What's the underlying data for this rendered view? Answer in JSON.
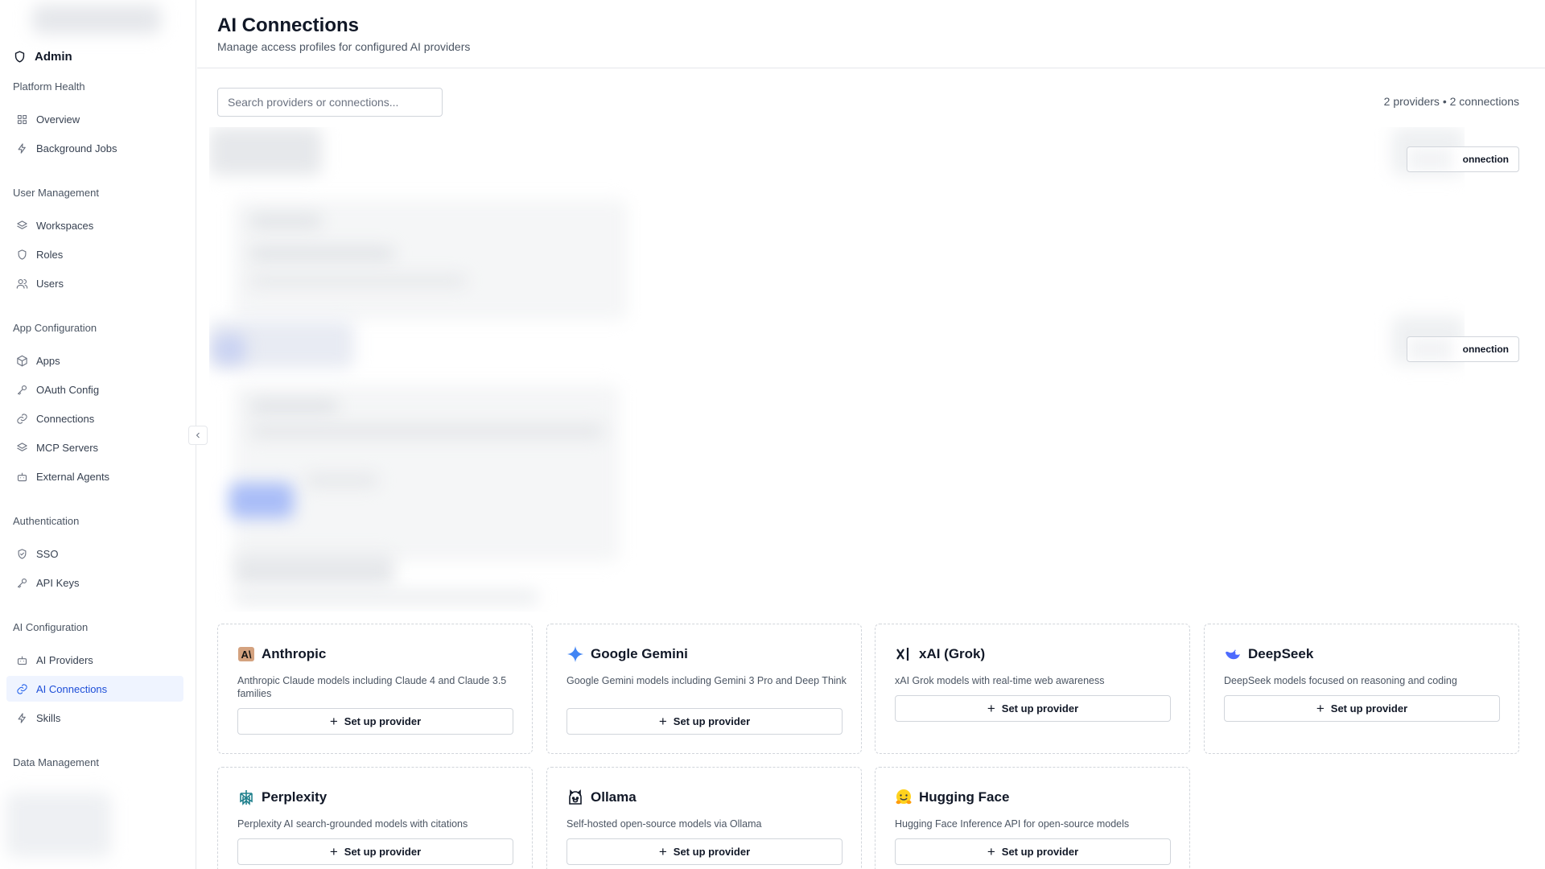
{
  "sidebar": {
    "admin_label": "Admin",
    "sections": [
      {
        "title": "Platform Health",
        "items": [
          {
            "label": "Overview",
            "icon": "grid-icon"
          },
          {
            "label": "Background Jobs",
            "icon": "lightning-icon"
          }
        ]
      },
      {
        "title": "User Management",
        "items": [
          {
            "label": "Workspaces",
            "icon": "layers-icon"
          },
          {
            "label": "Roles",
            "icon": "shield-icon"
          },
          {
            "label": "Users",
            "icon": "users-icon"
          }
        ]
      },
      {
        "title": "App Configuration",
        "items": [
          {
            "label": "Apps",
            "icon": "package-icon"
          },
          {
            "label": "OAuth Config",
            "icon": "key-icon"
          },
          {
            "label": "Connections",
            "icon": "link-icon"
          },
          {
            "label": "MCP Servers",
            "icon": "layers-icon"
          },
          {
            "label": "External Agents",
            "icon": "bot-icon"
          }
        ]
      },
      {
        "title": "Authentication",
        "items": [
          {
            "label": "SSO",
            "icon": "shield-check-icon"
          },
          {
            "label": "API Keys",
            "icon": "key-icon"
          }
        ]
      },
      {
        "title": "AI Configuration",
        "items": [
          {
            "label": "AI Providers",
            "icon": "bot-icon"
          },
          {
            "label": "AI Connections",
            "icon": "link-icon",
            "active": true
          },
          {
            "label": "Skills",
            "icon": "lightning-icon"
          }
        ]
      },
      {
        "title": "Data Management",
        "items": []
      }
    ]
  },
  "header": {
    "title": "AI Connections",
    "subtitle": "Manage access profiles for configured AI providers"
  },
  "toolbar": {
    "search_placeholder": "Search providers or connections...",
    "counts": "2 providers • 2 connections"
  },
  "connections": {
    "new_connection_label": "onnection"
  },
  "providers": [
    {
      "name": "Anthropic",
      "icon": "anthropic-icon",
      "description": "Anthropic Claude models including Claude 4 and Claude 3.5 families",
      "button": "Set up provider"
    },
    {
      "name": "Google Gemini",
      "icon": "gemini-icon",
      "description": "Google Gemini models including Gemini 3 Pro and Deep Think",
      "button": "Set up provider"
    },
    {
      "name": "xAI (Grok)",
      "icon": "xai-icon",
      "description": "xAI Grok models with real-time web awareness",
      "button": "Set up provider"
    },
    {
      "name": "DeepSeek",
      "icon": "deepseek-icon",
      "description": "DeepSeek models focused on reasoning and coding",
      "button": "Set up provider"
    },
    {
      "name": "Perplexity",
      "icon": "perplexity-icon",
      "description": "Perplexity AI search-grounded models with citations",
      "button": "Set up provider"
    },
    {
      "name": "Ollama",
      "icon": "ollama-icon",
      "description": "Self-hosted open-source models via Ollama",
      "button": "Set up provider"
    },
    {
      "name": "Hugging Face",
      "icon": "hugging-face-icon",
      "description": "Hugging Face Inference API for open-source models",
      "button": "Set up provider"
    }
  ],
  "colors": {
    "accent": "#2563eb",
    "active_bg": "#eff4ff",
    "border": "#e5e7eb"
  }
}
